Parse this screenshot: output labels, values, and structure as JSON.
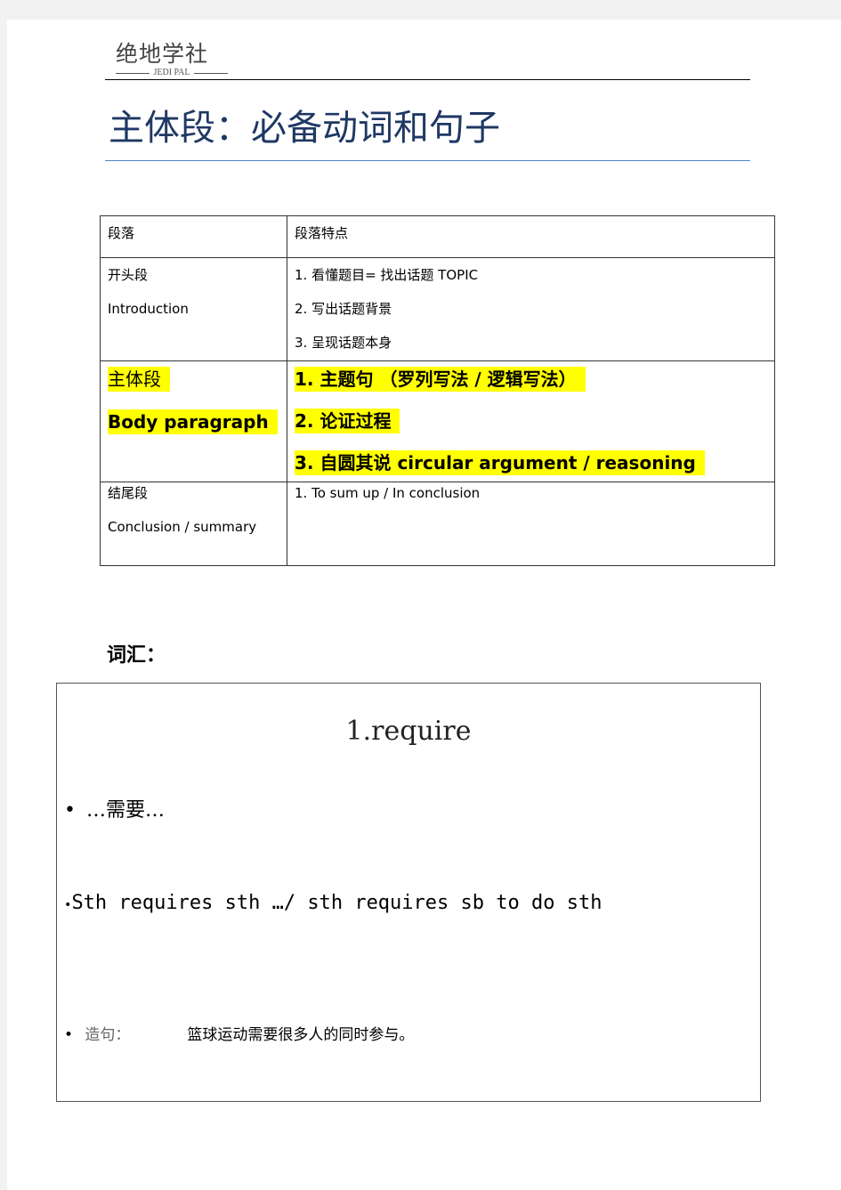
{
  "header": {
    "logo_cn": "绝地学社",
    "logo_en": "JEDI PAL"
  },
  "title": "主体段：必备动词和句子",
  "table": {
    "headers": [
      "段落",
      "段落特点"
    ],
    "rows": [
      {
        "name_cn": "开头段",
        "name_en": "Introduction",
        "points": [
          "1.  看懂题目= 找出话题 TOPIC",
          "2.  写出话题背景",
          "3.  呈现话题本身"
        ]
      },
      {
        "name_cn": "主体段",
        "name_en": "Body paragraph",
        "points": [
          "1.  主题句 （罗列写法 / 逻辑写法）",
          "2.  论证过程",
          "3.  自圆其说 circular argument / reasoning"
        ]
      },
      {
        "name_cn": "结尾段",
        "name_en": "Conclusion / summary",
        "points": [
          "1. To sum up / In conclusion"
        ]
      }
    ],
    "highlight_color": "#ffff00"
  },
  "vocab": {
    "label": "词汇：",
    "word_title": "1.require",
    "meaning": "…需要…",
    "usage": "Sth requires sth …/ sth requires sb to do sth",
    "example_label": "造句：",
    "example": "篮球运动需要很多人的同时参与。"
  }
}
